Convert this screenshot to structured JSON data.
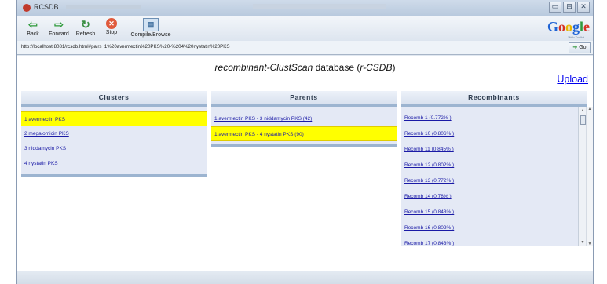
{
  "window": {
    "title": "RCSDB",
    "controls": [
      "▭",
      "⊟",
      "✕"
    ]
  },
  "toolbar": {
    "back": "Back",
    "forward": "Forward",
    "refresh": "Refresh",
    "stop": "Stop",
    "compile": "Compile/Browse"
  },
  "google": {
    "label": "Google",
    "sub": "Web Toolkit"
  },
  "address": {
    "url": "http://localhost:8081/rcsdb.html#pairs_1%20avermectin%20PKS%20-%204%20nystatin%20PKS",
    "go": "Go"
  },
  "page": {
    "title_italic": "recombinant-ClustScan",
    "title_normal": " database (",
    "title_abbrev": "r-CSDB",
    "title_close": ")",
    "upload": "Upload"
  },
  "clusters": {
    "header": "Clusters",
    "items": [
      "1 avermectin PKS",
      "2 megalomicin PKS",
      "3 niddamycin PKS",
      "4 nystatin PKS"
    ]
  },
  "parents": {
    "header": "Parents",
    "items": [
      "1 avermectin PKS - 3 niddamycin PKS (42)",
      "1 avermectin PKS - 4 nystatin PKS (90)"
    ]
  },
  "recombinants": {
    "header": "Recombinants",
    "items": [
      "Recomb 1 (0.772% )",
      "Recomb 10 (0.806% )",
      "Recomb 11 (0.845% )",
      "Recomb 12 (0.802% )",
      "Recomb 13 (0.772% )",
      "Recomb 14 (0.78% )",
      "Recomb 15 (0.843% )",
      "Recomb 16 (0.802% )",
      "Recomb 17 (0.843% )"
    ]
  },
  "colors": {
    "selected": "#ffff00",
    "link": "#1a1aa6",
    "panel_bg": "#e4e9f5",
    "header_border": "#9cb4d0"
  }
}
